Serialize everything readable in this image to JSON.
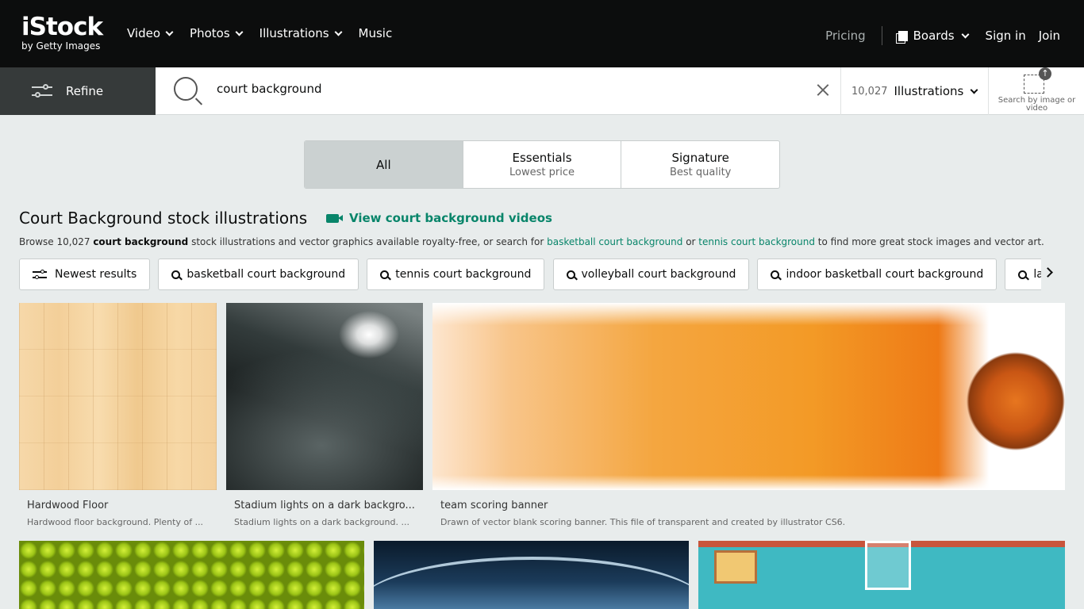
{
  "header": {
    "logo_main": "iStock",
    "logo_sub": "by Getty Images",
    "nav": [
      {
        "label": "Video",
        "has_dropdown": true
      },
      {
        "label": "Photos",
        "has_dropdown": true
      },
      {
        "label": "Illustrations",
        "has_dropdown": true
      },
      {
        "label": "Music",
        "has_dropdown": false
      }
    ],
    "pricing": "Pricing",
    "boards": "Boards",
    "sign_in": "Sign in",
    "join": "Join"
  },
  "search": {
    "refine_label": "Refine",
    "query": "court background",
    "result_count": "10,027",
    "asset_type": "Illustrations",
    "search_by_image_label": "Search by image or video"
  },
  "tabs": [
    {
      "title": "All",
      "subtitle": "",
      "active": true
    },
    {
      "title": "Essentials",
      "subtitle": "Lowest price",
      "active": false
    },
    {
      "title": "Signature",
      "subtitle": "Best quality",
      "active": false
    }
  ],
  "heading": "Court Background stock illustrations",
  "video_link": "View court background videos",
  "description": {
    "prefix": "Browse 10,027 ",
    "bold": "court background",
    "middle": " stock illustrations and vector graphics available royalty-free, or search for ",
    "link1": "basketball court background",
    "or": " or ",
    "link2": "tennis court background",
    "suffix": " to find more great stock images and vector art."
  },
  "chips": [
    {
      "label": "Newest results",
      "icon": "sliders-icon"
    },
    {
      "label": "basketball court background",
      "icon": "search-icon"
    },
    {
      "label": "tennis court background",
      "icon": "search-icon"
    },
    {
      "label": "volleyball court background",
      "icon": "search-icon"
    },
    {
      "label": "indoor basketball court background",
      "icon": "search-icon"
    },
    {
      "label": "law court background",
      "icon": "search-icon"
    }
  ],
  "results": [
    {
      "title": "Hardwood Floor",
      "description": "Hardwood floor background. Plenty of ..."
    },
    {
      "title": "Stadium lights on a dark backgro...",
      "description": "Stadium lights on a dark background. ..."
    },
    {
      "title": "team scoring banner",
      "description": "Drawn of vector blank scoring banner. This file of transparent and created by illustrator CS6."
    }
  ],
  "colors": {
    "accent": "#08856a",
    "header_bg": "#0c0d0d",
    "page_bg": "#e8ecec"
  }
}
